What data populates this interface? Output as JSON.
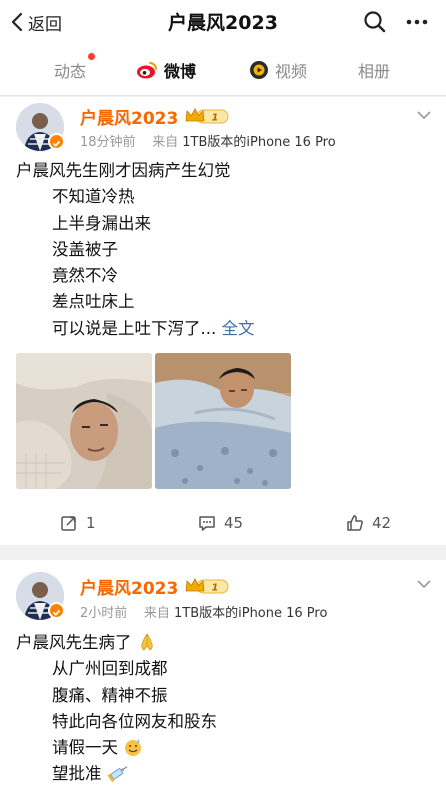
{
  "nav": {
    "back_label": "返回",
    "title": "户晨风2023"
  },
  "tabs": [
    {
      "label": "动态",
      "active": false,
      "has_dot": true
    },
    {
      "label": "微博",
      "active": true
    },
    {
      "label": "视频",
      "active": false
    },
    {
      "label": "相册",
      "active": false
    }
  ],
  "posts": [
    {
      "author": "户晨风2023",
      "member_level": "1",
      "time": "18分钟前",
      "source_prefix": "来自",
      "source": "1TB版本的iPhone 16 Pro",
      "lines": [
        "户晨风先生刚才因病产生幻觉",
        "不知道冷热",
        "上半身漏出来",
        "没盖被子",
        "竟然不冷",
        "差点吐床上",
        "可以说是上吐下泻了..."
      ],
      "full_text_link": "全文",
      "stats": {
        "reposts": "1",
        "comments": "45",
        "likes": "42"
      }
    },
    {
      "author": "户晨风2023",
      "member_level": "1",
      "time": "2小时前",
      "source_prefix": "来自",
      "source": "1TB版本的iPhone 16 Pro",
      "lines": [
        "户晨风先生病了",
        "从广州回到成都",
        "腹痛、精神不振",
        "特此向各位网友和股东",
        "请假一天",
        "望批准"
      ]
    }
  ],
  "colors": {
    "accent": "#f86800",
    "link": "#3e6fa8",
    "verify": "#ff8200"
  }
}
